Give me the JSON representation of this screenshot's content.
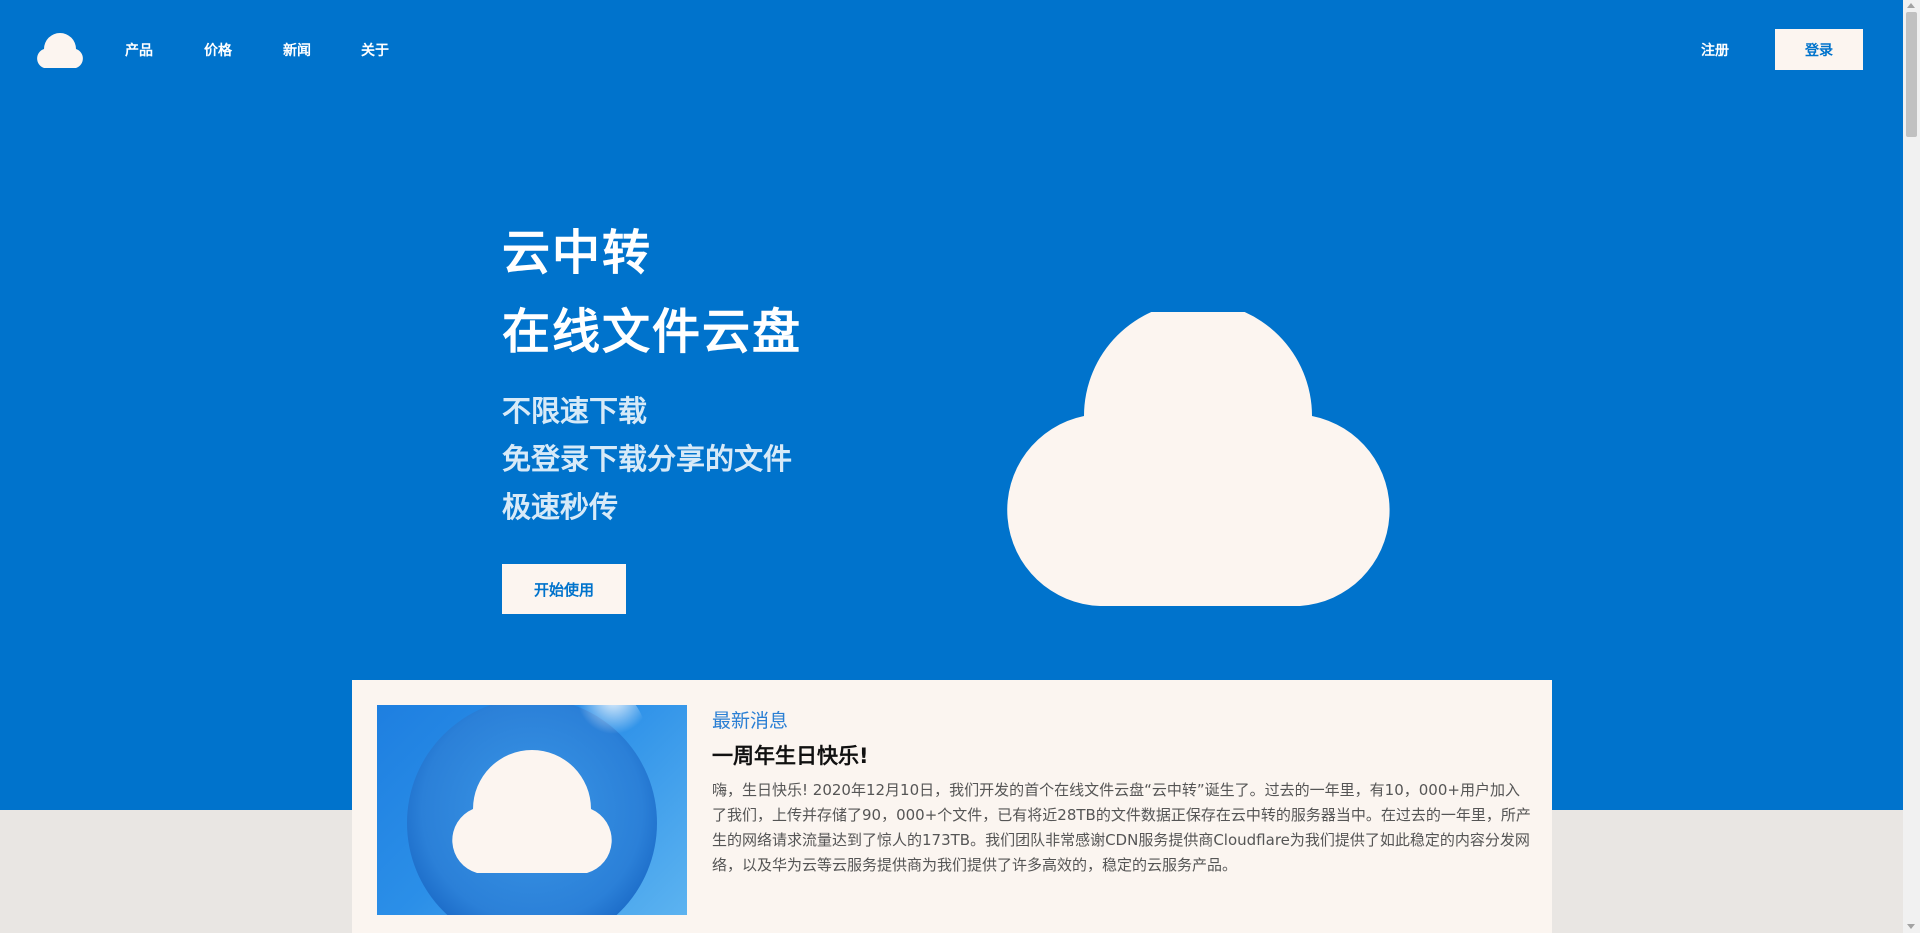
{
  "nav": {
    "links": [
      "产品",
      "价格",
      "新闻",
      "关于"
    ],
    "register_label": "注册",
    "login_label": "登录"
  },
  "hero": {
    "title_line1": "云中转",
    "title_line2": "在线文件云盘",
    "features": [
      "不限速下载",
      "免登录下载分享的文件",
      "极速秒传"
    ],
    "cta_label": "开始使用"
  },
  "news": {
    "label": "最新消息",
    "title": "一周年生日快乐!",
    "body": "嗨，生日快乐! 2020年12月10日，我们开发的首个在线文件云盘“云中转”诞生了。过去的一年里，有10，000+用户加入了我们，上传并存储了90，000+个文件，已有将近28TB的文件数据正保存在云中转的服务器当中。在过去的一年里，所产生的网络请求流量达到了惊人的173TB。我们团队非常感谢CDN服务提供商Cloudflare为我们提供了如此稳定的内容分发网络，以及华为云等云服务提供商为我们提供了许多高效的，稳定的云服务产品。"
  },
  "colors": {
    "brand_blue": "#0073cc",
    "cream": "#fcf5f0",
    "page_bg": "#e9e6e3"
  },
  "icons": {
    "logo": "cloud-icon",
    "hero_art": "cloud-icon"
  }
}
